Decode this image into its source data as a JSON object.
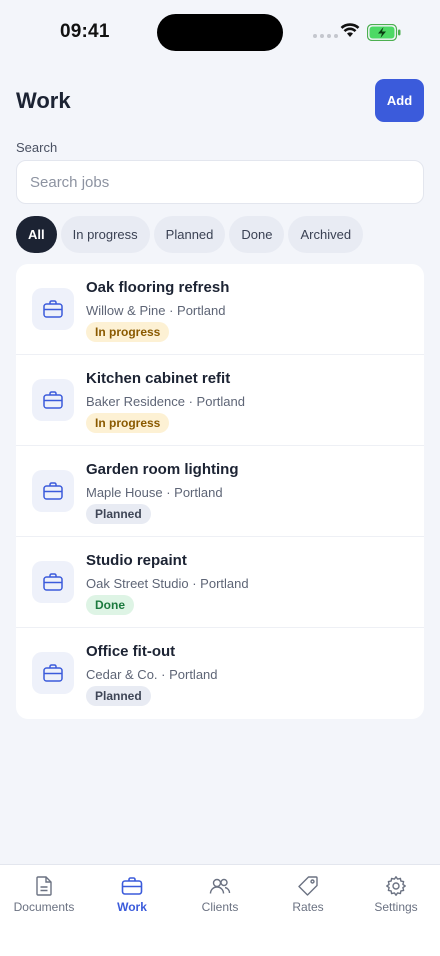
{
  "status_bar": {
    "time": "09:41"
  },
  "header": {
    "title": "Work",
    "add_label": "Add"
  },
  "search": {
    "label": "Search",
    "placeholder": "Search jobs",
    "value": ""
  },
  "filters": [
    {
      "label": "All",
      "active": true
    },
    {
      "label": "In progress",
      "active": false
    },
    {
      "label": "Planned",
      "active": false
    },
    {
      "label": "Done",
      "active": false
    },
    {
      "label": "Archived",
      "active": false
    }
  ],
  "jobs": [
    {
      "title": "Oak flooring refresh",
      "subtitle": "Willow & Pine · Portland",
      "status": "In progress",
      "status_kind": "in-progress"
    },
    {
      "title": "Kitchen cabinet refit",
      "subtitle": "Baker Residence · Portland",
      "status": "In progress",
      "status_kind": "in-progress"
    },
    {
      "title": "Garden room lighting",
      "subtitle": "Maple House · Portland",
      "status": "Planned",
      "status_kind": "planned"
    },
    {
      "title": "Studio repaint",
      "subtitle": "Oak Street Studio · Portland",
      "status": "Done",
      "status_kind": "done"
    },
    {
      "title": "Office fit-out",
      "subtitle": "Cedar & Co. · Portland",
      "status": "Planned",
      "status_kind": "planned"
    }
  ],
  "tab_bar": [
    {
      "label": "Documents",
      "icon": "document-icon",
      "active": false
    },
    {
      "label": "Work",
      "icon": "briefcase-icon",
      "active": true
    },
    {
      "label": "Clients",
      "icon": "users-icon",
      "active": false
    },
    {
      "label": "Rates",
      "icon": "tag-icon",
      "active": false
    },
    {
      "label": "Settings",
      "icon": "gear-icon",
      "active": false
    }
  ],
  "colors": {
    "accent": "#3b5bdb",
    "background": "#f3f5fa",
    "chip_active": "#1c2333",
    "status_in_progress": "#fdf1d4",
    "status_planned": "#e8ebf3",
    "status_done": "#def4e5"
  }
}
